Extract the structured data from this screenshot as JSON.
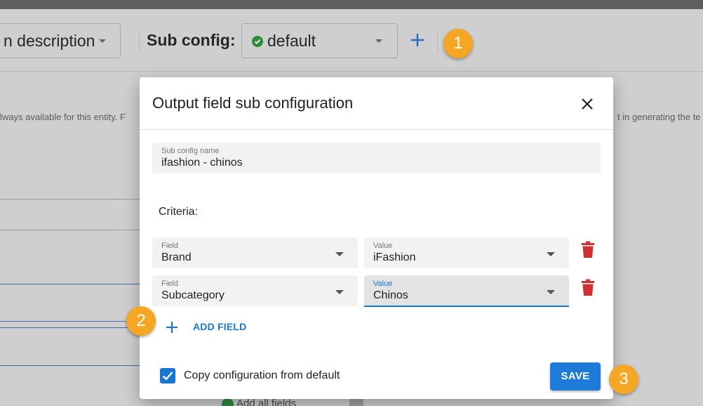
{
  "background": {
    "description_select_value": "n description",
    "sub_config_label": "Sub config:",
    "sub_config_select_value": "default",
    "info_text_left": "lways available for this entity. F",
    "info_text_right": "t in generating the te",
    "add_all_fields_label": "Add all fields"
  },
  "badges": [
    "1",
    "2",
    "3"
  ],
  "dialog": {
    "title": "Output field sub configuration",
    "name_field": {
      "label": "Sub config name",
      "value": "ifashion - chinos"
    },
    "criteria_label": "Criteria:",
    "criteria_rows": [
      {
        "field_label": "Field",
        "field_value": "Brand",
        "value_label": "Value",
        "value_value": "iFashion"
      },
      {
        "field_label": "Field",
        "field_value": "Subcategory",
        "value_label": "Value",
        "value_value": "Chinos"
      }
    ],
    "add_field_label": "ADD FIELD",
    "copy_checkbox": {
      "label": "Copy configuration from default",
      "checked": true
    },
    "save_label": "SAVE"
  },
  "colors": {
    "accent_blue": "#1976d2",
    "badge_orange": "#f5a623",
    "delete_red": "#d32f2f",
    "success_green": "#2e8b3c"
  },
  "icons": [
    "check-circle-icon",
    "plus-icon",
    "close-icon",
    "delete-icon",
    "checkbox-checked-icon",
    "chevron-down-icon"
  ]
}
